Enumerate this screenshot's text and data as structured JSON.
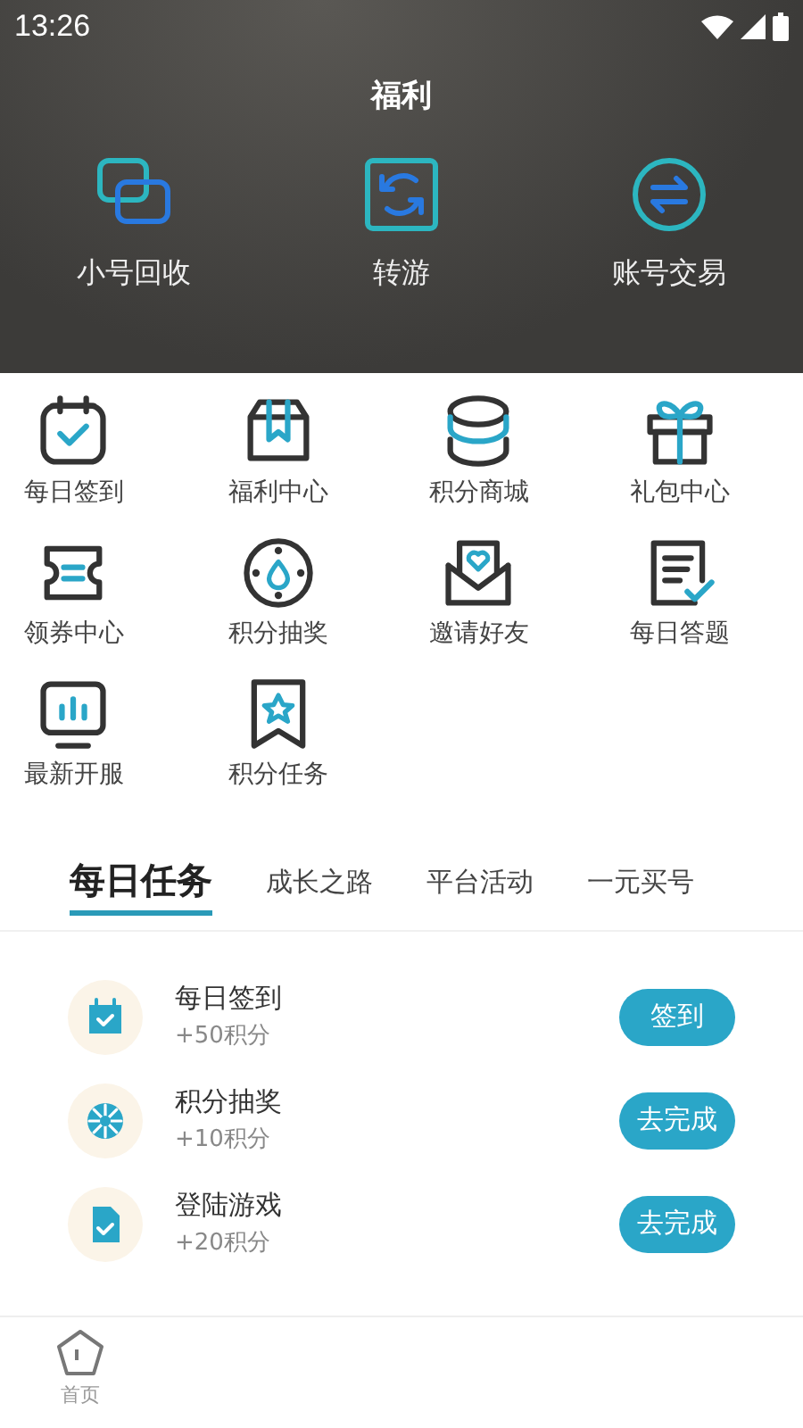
{
  "status_bar": {
    "time": "13:26"
  },
  "header": {
    "title": "福利",
    "shortcuts": [
      {
        "kind": "recycle",
        "label": "小号回收"
      },
      {
        "kind": "transfer",
        "label": "转游"
      },
      {
        "kind": "trade",
        "label": "账号交易"
      }
    ]
  },
  "features": [
    {
      "kind": "calendar",
      "label": "每日签到"
    },
    {
      "kind": "box",
      "label": "福利中心"
    },
    {
      "kind": "coins",
      "label": "积分商城"
    },
    {
      "kind": "gift",
      "label": "礼包中心"
    },
    {
      "kind": "ticket",
      "label": "领券中心"
    },
    {
      "kind": "wheel",
      "label": "积分抽奖"
    },
    {
      "kind": "envelope",
      "label": "邀请好友"
    },
    {
      "kind": "quiz",
      "label": "每日答题"
    },
    {
      "kind": "monitor",
      "label": "最新开服"
    },
    {
      "kind": "star",
      "label": "积分任务"
    }
  ],
  "tabs": [
    {
      "label": "每日任务",
      "selected": true
    },
    {
      "label": "成长之路",
      "selected": false
    },
    {
      "label": "平台活动",
      "selected": false
    },
    {
      "label": "一元买号",
      "selected": false
    }
  ],
  "tasks": [
    {
      "kind": "calendar",
      "title": "每日签到",
      "reward": "+50积分",
      "action": "签到"
    },
    {
      "kind": "wheel",
      "title": "积分抽奖",
      "reward": "+10积分",
      "action": "去完成"
    },
    {
      "kind": "document",
      "title": "登陆游戏",
      "reward": "+20积分",
      "action": "去完成"
    }
  ],
  "bottom_nav": [
    {
      "label": "首页",
      "selected": false
    }
  ]
}
